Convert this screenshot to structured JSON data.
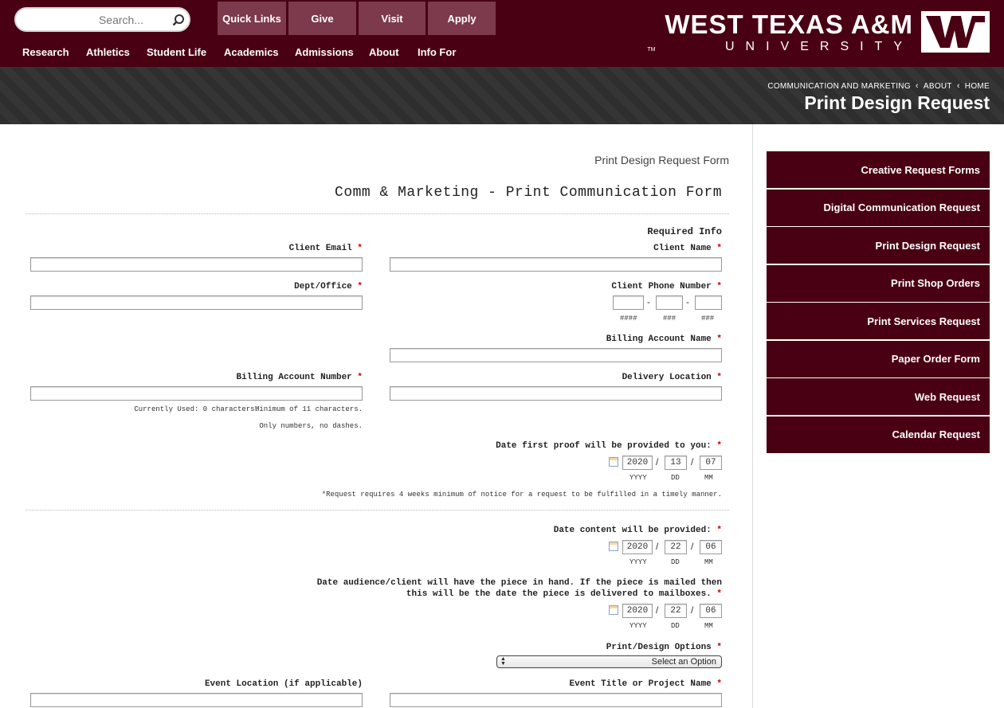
{
  "header": {
    "logo_line1": "WEST TEXAS A&M",
    "logo_line2": "UNIVERSITY",
    "logo_tm": "TM",
    "search_placeholder": "Search...",
    "quick_buttons": [
      "Quick Links",
      "Give",
      "Visit",
      "Apply"
    ],
    "nav": [
      "Research",
      "Athletics",
      "Student Life",
      "Academics",
      "Admissions",
      "About",
      "Info For"
    ],
    "brand_color": "#4a0013"
  },
  "banner": {
    "breadcrumbs": [
      "HOME",
      "ABOUT",
      "COMMUNICATION AND MARKETING"
    ],
    "title": "Print Design Request"
  },
  "sidebar": {
    "items": [
      "Creative Request Forms",
      "Digital Communication Request",
      "Print Design Request",
      "Print Shop Orders",
      "Print Services Request",
      "Paper Order Form",
      "Web Request",
      "Calendar Request"
    ]
  },
  "form": {
    "crumb": "Print Design Request Form",
    "title": "Comm & Marketing - Print Communication Form",
    "required_info": "Required Info",
    "client_name": "Client Name",
    "client_email": "Client Email",
    "client_phone": "Client Phone Number",
    "dept_office": "Dept/Office",
    "phone_hints": [
      "###",
      "###",
      "####"
    ],
    "billing_account_name": "Billing Account Name",
    "delivery_location": "Delivery Location",
    "billing_account_number": "Billing Account Number",
    "billing_hint_min": "Minimum of 11 characters.",
    "billing_hint_used": "Currently Used: 0 characters.",
    "billing_hint_numbers": "Only numbers, no dashes.",
    "first_proof_label": "Date first proof will be provided to you:",
    "first_proof": {
      "mm": "07",
      "dd": "13",
      "yyyy": "2020"
    },
    "date_hints": [
      "MM",
      "DD",
      "YYYY"
    ],
    "first_proof_note": "*Request requires 4 weeks minimum of notice for a request to be fulfilled in a timely manner.",
    "content_date_label": "Date content will be provided:",
    "content_date": {
      "mm": "06",
      "dd": "22",
      "yyyy": "2020"
    },
    "inhand_label_1": "Date audience/client will have the piece in hand. If the piece is mailed then",
    "inhand_label_2": "this will be the date the piece is delivered to mailboxes.",
    "inhand_date": {
      "mm": "06",
      "dd": "22",
      "yyyy": "2020"
    },
    "print_options_label": "Print/Design Options",
    "print_options_value": "Select an Option",
    "event_title_label": "Event Title or Project Name",
    "event_location_label": "Event Location (if applicable)",
    "asterisk": "*",
    "date_sep": "/",
    "phone_sep": "-"
  }
}
